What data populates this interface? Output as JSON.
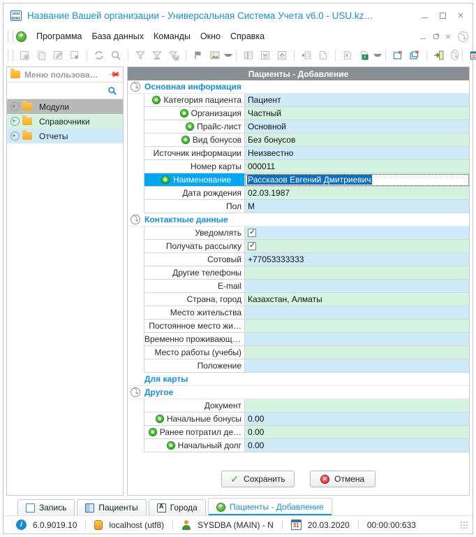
{
  "window": {
    "title": "Название Вашей организации - Универсальная Система Учета v6.0 - USU.kz…",
    "logo_name": "usu-logo",
    "controls": {
      "minimize": "minimize",
      "maximize": "maximize",
      "close": "close"
    }
  },
  "menubar": {
    "items": [
      "Программа",
      "База данных",
      "Команды",
      "Окно",
      "Справка"
    ],
    "mdi_controls": [
      "minimize",
      "restore",
      "close",
      "expand"
    ]
  },
  "toolbar": {
    "groups": [
      [
        "add-record-icon",
        "copy-record-icon",
        "edit-record-icon",
        "delete-record-icon"
      ],
      [
        "refresh-icon",
        "search-icon"
      ],
      [
        "filter-icon",
        "filter-clear-icon",
        "filter-apply-icon"
      ],
      [
        "flag-icon",
        "image-icon-dropdown"
      ],
      [
        "columns-icon",
        "expand-all-icon",
        "collapse-all-icon"
      ],
      [
        "group-icon",
        "blank-page-icon"
      ],
      [
        "export-icon",
        "export-excel-icon-dropdown"
      ],
      [
        "new-window-icon",
        "close-window-icon"
      ],
      [
        "exit-icon",
        "more-icon"
      ],
      [
        "calendar-icon",
        "overflow-icon"
      ]
    ]
  },
  "sidebar": {
    "title": "Меню пользова…",
    "pin": "pin-icon",
    "search_icon": "search-icon",
    "items": [
      {
        "label": "Модули",
        "state": "selected"
      },
      {
        "label": "Справочники",
        "state": "green"
      },
      {
        "label": "Отчеты",
        "state": "blue"
      }
    ]
  },
  "form": {
    "header": "Пациенты - Добавление",
    "sections": [
      {
        "title": "Основная информация",
        "collapsible": true,
        "rows": [
          {
            "label": "Категория пациента",
            "value": "Пациент",
            "zebra": "blue",
            "has_dot": true,
            "type": "text"
          },
          {
            "label": "Организация",
            "value": "Частный",
            "zebra": "green",
            "has_dot": true,
            "type": "text"
          },
          {
            "label": "Прайс-лист",
            "value": "Основной",
            "zebra": "blue",
            "has_dot": true,
            "type": "text"
          },
          {
            "label": "Вид бонусов",
            "value": "Без бонусов",
            "zebra": "green",
            "has_dot": true,
            "type": "text"
          },
          {
            "label": "Источник информации",
            "value": "Неизвестно",
            "zebra": "blue",
            "has_dot": false,
            "type": "text"
          },
          {
            "label": "Номер карты",
            "value": "000011",
            "zebra": "green",
            "has_dot": false,
            "type": "text"
          },
          {
            "label": "Наименование",
            "value": "Рассказов Евгений Дмитриевич",
            "zebra": "green",
            "has_dot": true,
            "type": "editing",
            "selected": true
          },
          {
            "label": "Дата рождения",
            "value": "02.03.1987",
            "zebra": "green",
            "has_dot": false,
            "type": "text"
          },
          {
            "label": "Пол",
            "value": "М",
            "zebra": "blue",
            "has_dot": false,
            "type": "text"
          }
        ]
      },
      {
        "title": "Контактные данные",
        "collapsible": true,
        "rows": [
          {
            "label": "Уведомлять",
            "value": "",
            "zebra": "blue",
            "has_dot": false,
            "type": "checkbox",
            "checked": true
          },
          {
            "label": "Получать рассылку",
            "value": "",
            "zebra": "green",
            "has_dot": false,
            "type": "checkbox",
            "checked": true
          },
          {
            "label": "Сотовый",
            "value": "+77053333333",
            "zebra": "blue",
            "has_dot": false,
            "type": "text"
          },
          {
            "label": "Другие телефоны",
            "value": "",
            "zebra": "green",
            "has_dot": false,
            "type": "text"
          },
          {
            "label": "E-mail",
            "value": "",
            "zebra": "blue",
            "has_dot": false,
            "type": "text"
          },
          {
            "label": "Страна, город",
            "value": "Казахстан, Алматы",
            "zebra": "green",
            "has_dot": false,
            "type": "text"
          },
          {
            "label": "Место жительства",
            "value": "",
            "zebra": "blue",
            "has_dot": false,
            "type": "text"
          },
          {
            "label": "Постоянное место жи…",
            "value": "",
            "zebra": "green",
            "has_dot": false,
            "type": "text"
          },
          {
            "label": "Временно проживающий",
            "value": "",
            "zebra": "blue",
            "has_dot": false,
            "type": "text"
          },
          {
            "label": "Место работы (учебы)",
            "value": "",
            "zebra": "green",
            "has_dot": false,
            "type": "text"
          },
          {
            "label": "Положение",
            "value": "",
            "zebra": "blue",
            "has_dot": false,
            "type": "text"
          }
        ]
      },
      {
        "title": "Для карты",
        "collapsible": false,
        "rows": []
      },
      {
        "title": "Другое",
        "collapsible": true,
        "rows": [
          {
            "label": "Документ",
            "value": "",
            "zebra": "green",
            "has_dot": false,
            "type": "text"
          },
          {
            "label": "Начальные бонусы",
            "value": "0.00",
            "zebra": "blue",
            "has_dot": true,
            "type": "text"
          },
          {
            "label": "Ранее потратил де…",
            "value": "0.00",
            "zebra": "green",
            "has_dot": true,
            "type": "text"
          },
          {
            "label": "Начальный долг",
            "value": "0.00",
            "zebra": "blue",
            "has_dot": true,
            "type": "text"
          }
        ]
      }
    ],
    "buttons": {
      "save": "Сохранить",
      "cancel": "Отмена"
    }
  },
  "tabs": [
    {
      "label": "Запись",
      "icon": "record-icon",
      "active": false
    },
    {
      "label": "Пациенты",
      "icon": "patients-icon",
      "active": false
    },
    {
      "label": "Города",
      "icon": "cities-icon",
      "active": false
    },
    {
      "label": "Пациенты - Добавление",
      "icon": "add-icon",
      "active": true
    }
  ],
  "statusbar": {
    "version": "6.0.9019.10",
    "server": "localhost (utf8)",
    "user": "SYSDBA (MAIN) - N",
    "date": "20.03.2020",
    "time": "00:00:00:633"
  },
  "colors": {
    "accent_blue": "#1a8fd4",
    "selection_blue": "#00a6f0",
    "zebra_blue": "#cfeaf8",
    "zebra_green": "#d4f3e0",
    "header_gray": "#8a8f94"
  }
}
